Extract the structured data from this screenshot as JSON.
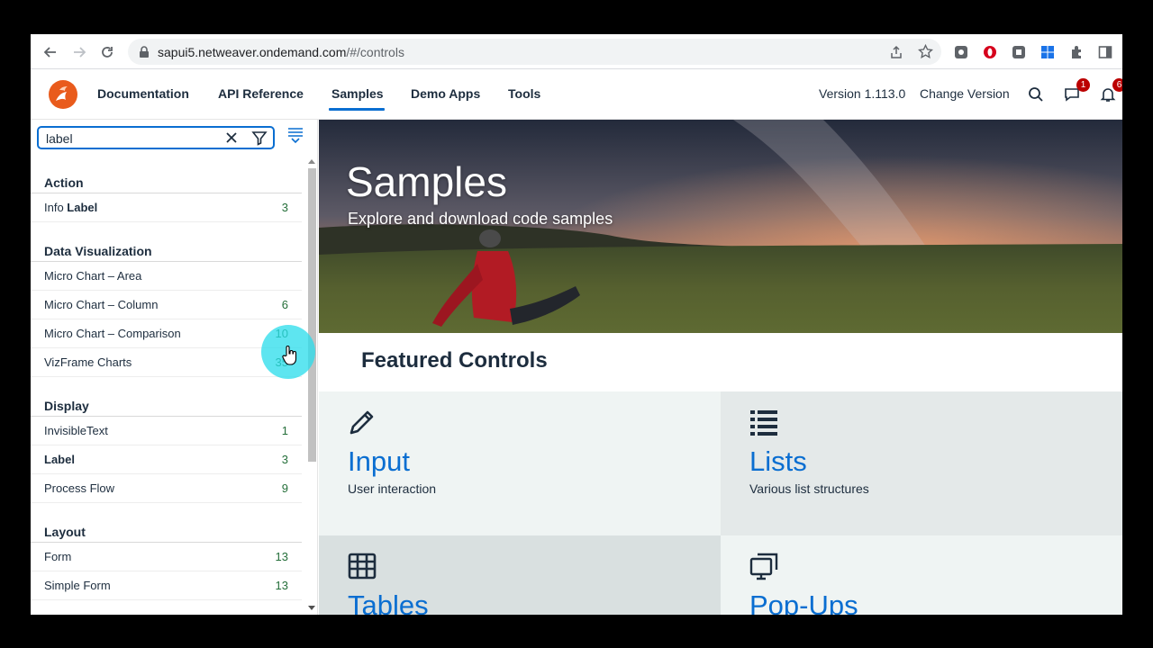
{
  "browser": {
    "url_host": "sapui5.netweaver.ondemand.com",
    "url_path": "/#/controls"
  },
  "header": {
    "nav": [
      {
        "label": "Documentation"
      },
      {
        "label": "API Reference"
      },
      {
        "label": "Samples"
      },
      {
        "label": "Demo Apps"
      },
      {
        "label": "Tools"
      }
    ],
    "active_nav": "Samples",
    "version": "Version 1.113.0",
    "change_version": "Change Version",
    "feedback_badge": "1",
    "notifications_badge": "6"
  },
  "sidebar": {
    "search_value": "label",
    "groups": [
      {
        "name": "Action",
        "items": [
          {
            "prefix": "Info ",
            "highlight": "Label",
            "count": "3"
          }
        ]
      },
      {
        "name": "Data Visualization",
        "items": [
          {
            "label": "Micro Chart – Area",
            "count": ""
          },
          {
            "label": "Micro Chart – Column",
            "count": "6"
          },
          {
            "label": "Micro Chart – Comparison",
            "count": "10"
          },
          {
            "label": "VizFrame Charts",
            "count": "35"
          }
        ]
      },
      {
        "name": "Display",
        "items": [
          {
            "label": "InvisibleText",
            "count": "1"
          },
          {
            "highlight": "Label",
            "count": "3"
          },
          {
            "label": "Process Flow",
            "count": "9"
          }
        ]
      },
      {
        "name": "Layout",
        "items": [
          {
            "label": "Form",
            "count": "13"
          },
          {
            "label": "Simple Form",
            "count": "13"
          }
        ]
      }
    ]
  },
  "main": {
    "hero_title": "Samples",
    "hero_subtitle": "Explore and download code samples",
    "featured_title": "Featured Controls",
    "tiles": [
      {
        "title": "Input",
        "subtitle": "User interaction",
        "icon": "pencil-icon"
      },
      {
        "title": "Lists",
        "subtitle": "Various list structures",
        "icon": "list-icon"
      },
      {
        "title": "Tables",
        "subtitle": "",
        "icon": "table-icon"
      },
      {
        "title": "Pop-Ups",
        "subtitle": "",
        "icon": "popup-icon"
      }
    ]
  },
  "colors": {
    "accent": "#0a6ed1",
    "count_green": "#256f3a",
    "badge_red": "#bb0000"
  }
}
